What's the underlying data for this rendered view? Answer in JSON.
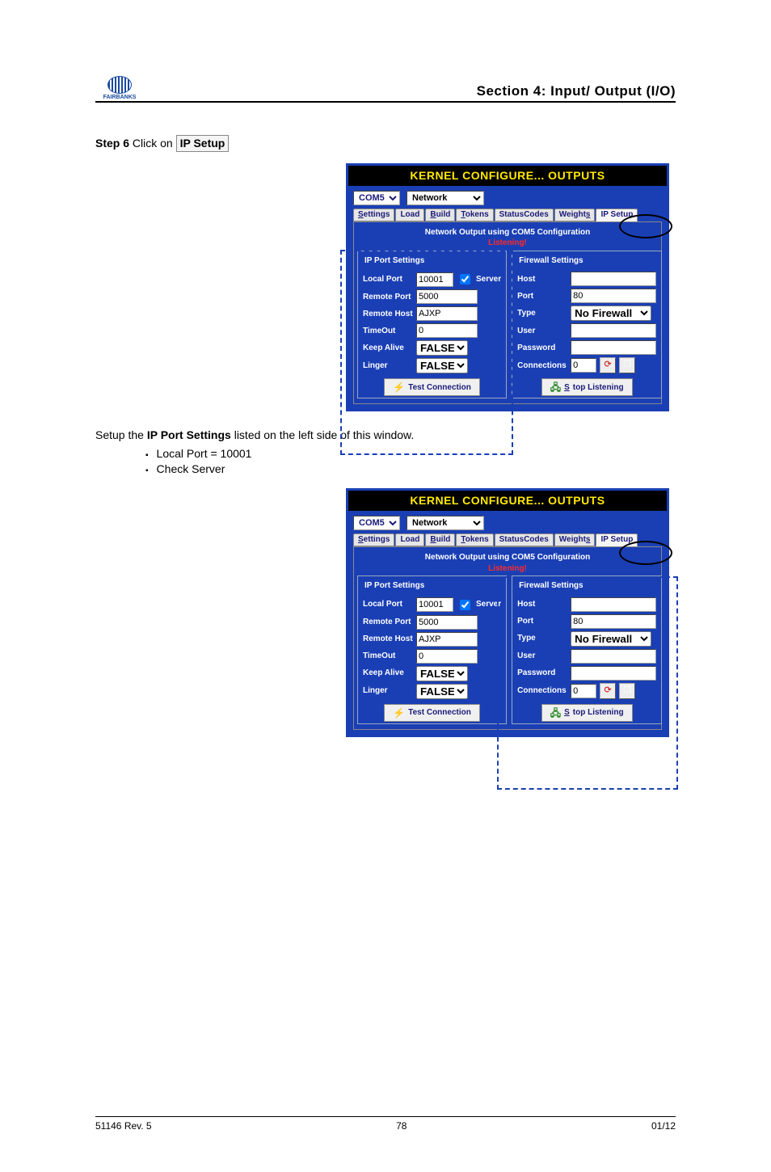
{
  "header": {
    "section_title": "Section 4: Input/ Output (I/O)",
    "logo_text": "FAIRBANKS"
  },
  "intro": {
    "step_label": "Step 6",
    "step_text": "Click on ",
    "btn_label": "IP Setup"
  },
  "window": {
    "title": "KERNEL CONFIGURE... OUTPUTS",
    "com_select": "COM5",
    "net_select": "Network",
    "tabs": {
      "settings": "Settings",
      "load": "Load",
      "build": "Build",
      "tokens": "Tokens",
      "status": "StatusCodes",
      "weights": "Weights",
      "ipsetup": "IP Setup"
    },
    "subtitle": "Network Output using COM5 Configuration",
    "listening": "Listening!",
    "left": {
      "group": "IP Port Settings",
      "local_port_lbl": "Local Port",
      "local_port_val": "10001",
      "server_lbl": "Server",
      "remote_port_lbl": "Remote Port",
      "remote_port_val": "5000",
      "remote_host_lbl": "Remote Host",
      "remote_host_val": "AJXP",
      "timeout_lbl": "TimeOut",
      "timeout_val": "0",
      "keepalive_lbl": "Keep Alive",
      "keepalive_val": "FALSE",
      "linger_lbl": "Linger",
      "linger_val": "FALSE",
      "test_conn": "Test Connection"
    },
    "right": {
      "group": "Firewall Settings",
      "host_lbl": "Host",
      "host_val": "",
      "port_lbl": "Port",
      "port_val": "80",
      "type_lbl": "Type",
      "type_val": "No Firewall",
      "user_lbl": "User",
      "user_val": "",
      "pass_lbl": "Password",
      "pass_val": "",
      "conn_lbl": "Connections",
      "conn_val": "0",
      "stop_listen": "Stop Listening"
    }
  },
  "mid_text": {
    "line1a": "Setup the ",
    "line1b": "IP Port Settings",
    "line1c": " listed on the left side of this window.",
    "b1": "Local Port = 10001",
    "b2": "Check Server"
  },
  "footer": {
    "left": "51146 Rev. 5",
    "center": "78",
    "right": "01/12"
  }
}
